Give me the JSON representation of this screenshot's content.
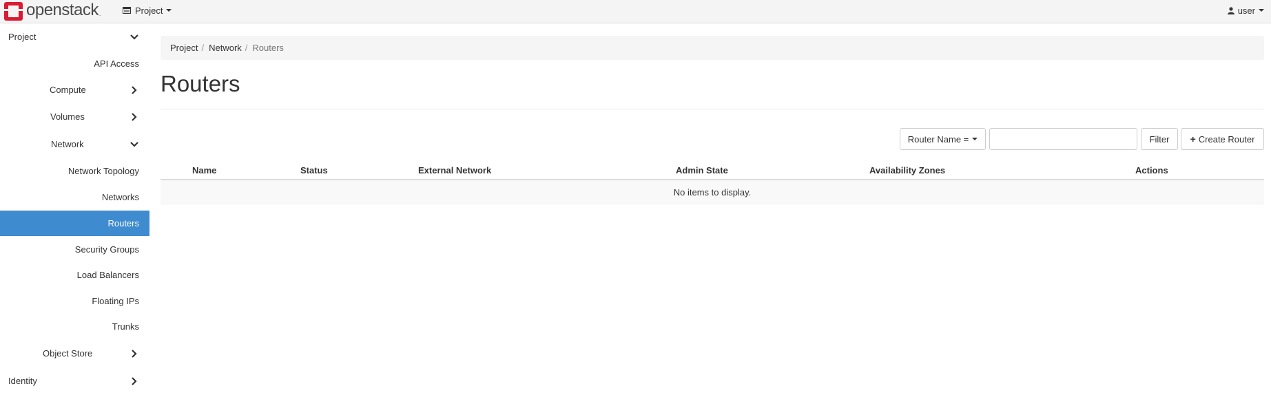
{
  "navbar": {
    "brand": "openstack",
    "brand_suffix": ".",
    "project_menu": "Project",
    "user_menu": "user"
  },
  "sidebar": {
    "items": [
      {
        "label": "Project",
        "chevron": "down"
      },
      {
        "label": "API Access"
      },
      {
        "label": "Compute",
        "chevron": "right"
      },
      {
        "label": "Volumes",
        "chevron": "right"
      },
      {
        "label": "Network",
        "chevron": "down"
      },
      {
        "label": "Network Topology"
      },
      {
        "label": "Networks"
      },
      {
        "label": "Routers",
        "active": true
      },
      {
        "label": "Security Groups"
      },
      {
        "label": "Load Balancers"
      },
      {
        "label": "Floating IPs"
      },
      {
        "label": "Trunks"
      },
      {
        "label": "Object Store",
        "chevron": "right"
      },
      {
        "label": "Identity",
        "chevron": "right"
      }
    ]
  },
  "breadcrumb": [
    "Project",
    "Network",
    "Routers"
  ],
  "page": {
    "title": "Routers"
  },
  "filter": {
    "field_label": "Router Name =",
    "input_value": "",
    "filter_button": "Filter",
    "create_button": "Create Router"
  },
  "table": {
    "columns": [
      "Name",
      "Status",
      "External Network",
      "Admin State",
      "Availability Zones",
      "Actions"
    ],
    "empty_message": "No items to display."
  },
  "colors": {
    "active": "#3f8bd0",
    "brand_red": "#da1a32"
  }
}
